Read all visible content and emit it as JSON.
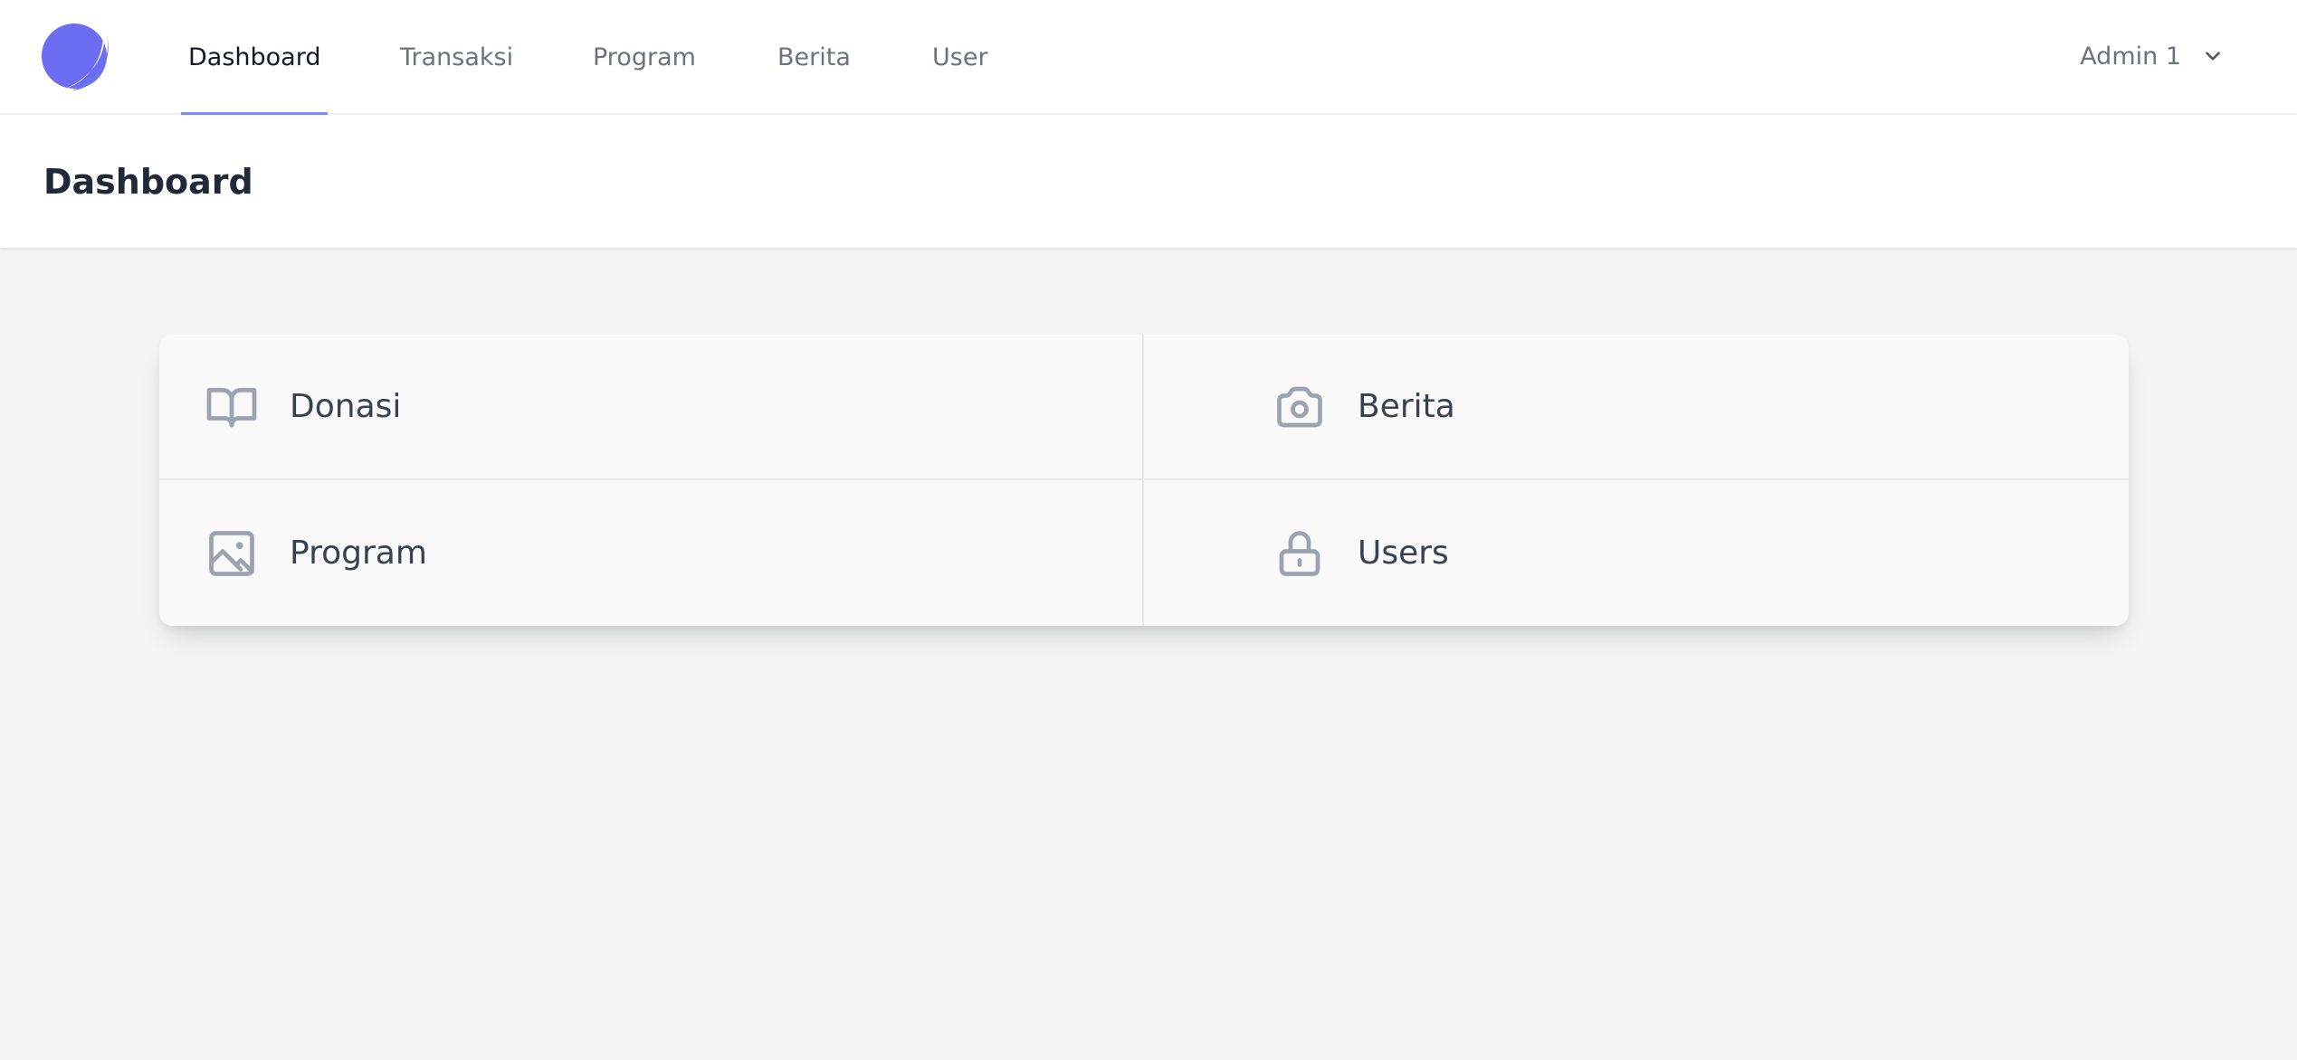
{
  "nav": {
    "logo": "planet-logo-icon",
    "links": [
      {
        "label": "Dashboard",
        "active": true
      },
      {
        "label": "Transaksi",
        "active": false
      },
      {
        "label": "Program",
        "active": false
      },
      {
        "label": "Berita",
        "active": false
      },
      {
        "label": "User",
        "active": false
      }
    ],
    "user_menu": {
      "label": "Admin 1",
      "icon": "chevron-down-icon"
    }
  },
  "header": {
    "title": "Dashboard"
  },
  "tiles": [
    {
      "label": "Donasi",
      "icon": "book-open-icon"
    },
    {
      "label": "Berita",
      "icon": "camera-icon"
    },
    {
      "label": "Program",
      "icon": "image-icon"
    },
    {
      "label": "Users",
      "icon": "lock-icon"
    }
  ],
  "colors": {
    "accent": "#6366f1",
    "active_underline": "#818cf8",
    "page_background": "#f3f4f6",
    "tile_background": "#f9f9f9",
    "icon_gray": "#9ca3af"
  }
}
